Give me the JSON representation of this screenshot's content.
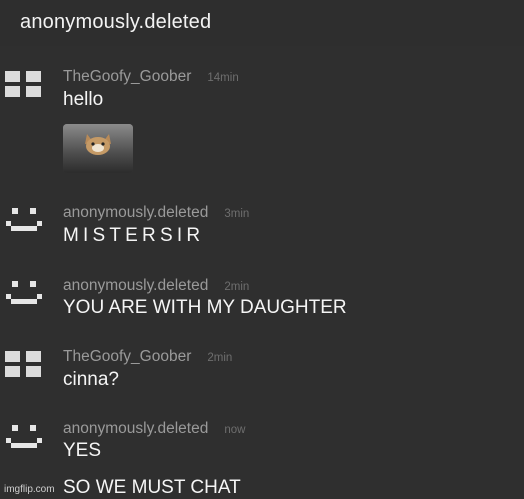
{
  "header": {
    "title": "anonymously.deleted"
  },
  "messages": [
    {
      "user": "TheGoofy_Goober",
      "time": "14min",
      "text": "hello",
      "avatar": "grid-avatar-icon",
      "attachment": "cat-thumbnail"
    },
    {
      "user": "anonymously.deleted",
      "time": "3min",
      "text": "MISTERSIR",
      "avatar": "smiley-avatar-icon"
    },
    {
      "user": "anonymously.deleted",
      "time": "2min",
      "text": "YOU ARE WITH MY DAUGHTER",
      "avatar": "smiley-avatar-icon"
    },
    {
      "user": "TheGoofy_Goober",
      "time": "2min",
      "text": "cinna?",
      "avatar": "grid-avatar-icon"
    },
    {
      "user": "anonymously.deleted",
      "time": "now",
      "text": "YES",
      "avatar": "smiley-avatar-icon"
    },
    {
      "text": "SO WE MUST CHAT"
    }
  ],
  "watermark": "imgflip.com",
  "colors": {
    "background": "#2f2f2f",
    "username": "#9a9a9a",
    "timestamp": "#6e6e6e",
    "text": "#f5f5f5"
  }
}
